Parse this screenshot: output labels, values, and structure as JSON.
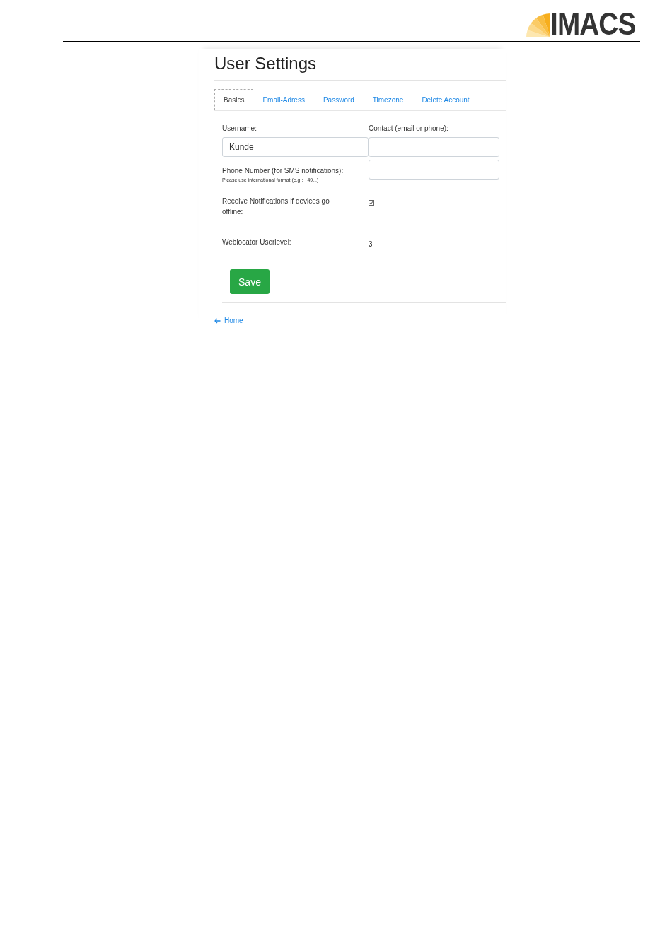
{
  "logo": {
    "text": "IMACS"
  },
  "title": "User Settings",
  "tabs": [
    {
      "label": "Basics",
      "selected": true
    },
    {
      "label": "Email-Adress",
      "selected": false
    },
    {
      "label": "Password",
      "selected": false
    },
    {
      "label": "Timezone",
      "selected": false
    },
    {
      "label": "Delete Account",
      "selected": false
    }
  ],
  "fields": [
    {
      "kind": "input",
      "label": "Username:",
      "value": "Kunde"
    },
    {
      "kind": "input",
      "label": "Contact (email or phone):"
    },
    {
      "kind": "input",
      "label": "Phone Number (for SMS notifications):",
      "hint": "Please use international format (e.g.: +49...)"
    },
    {
      "kind": "checkbox",
      "label": "Receive Notifications if devices go offline:",
      "checked": true
    },
    {
      "kind": "value",
      "label": "Weblocator Userlevel:",
      "value": "3"
    }
  ],
  "save_button": "Save",
  "home_link": "Home"
}
